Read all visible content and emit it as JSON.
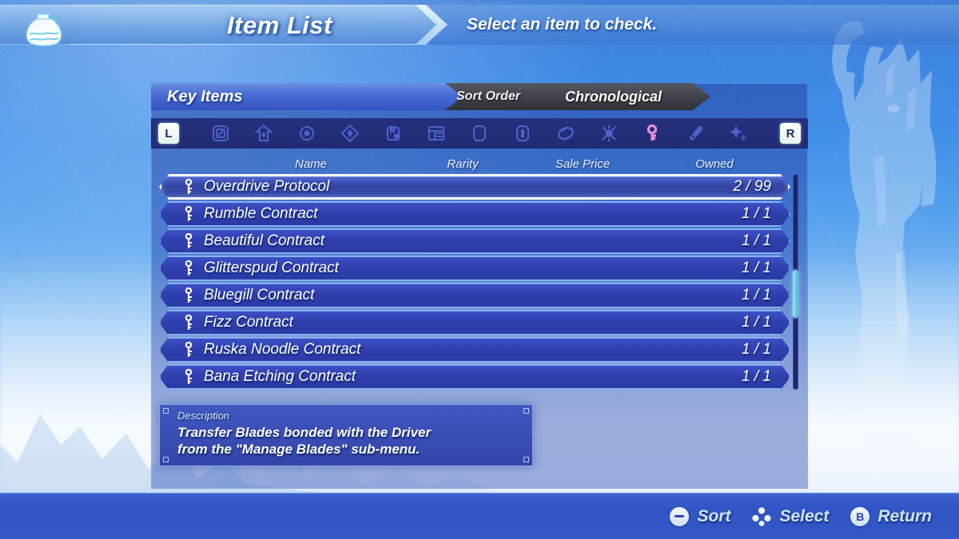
{
  "header": {
    "icon": "pot-icon",
    "title": "Item List",
    "subtitle": "Select an item to check."
  },
  "panel": {
    "category_tab": "Key Items",
    "sort_label": "Sort Order",
    "sort_value": "Chronological",
    "left_bumper": "L",
    "right_bumper": "R",
    "category_icons": [
      {
        "name": "core-chip-icon",
        "active": false
      },
      {
        "name": "aux-core-icon",
        "active": false
      },
      {
        "name": "pouch-item-icon",
        "active": false
      },
      {
        "name": "crystal-icon",
        "active": false
      },
      {
        "name": "collectible-icon",
        "active": false
      },
      {
        "name": "book-icon",
        "active": false
      },
      {
        "name": "cylinder-icon",
        "active": false
      },
      {
        "name": "ether-crystal-icon",
        "active": false
      },
      {
        "name": "ring-icon",
        "active": false
      },
      {
        "name": "accessory-icon",
        "active": false
      },
      {
        "name": "key-item-icon",
        "active": true
      },
      {
        "name": "treasure-icon",
        "active": false
      },
      {
        "name": "sparkle-icon",
        "active": false
      }
    ],
    "columns": [
      "Name",
      "Rarity",
      "Sale Price",
      "Owned"
    ],
    "items": [
      {
        "icon": "key-icon",
        "name": "Overdrive Protocol",
        "rarity": "",
        "sale_price": "",
        "owned": "2 / 99",
        "selected": true
      },
      {
        "icon": "key-icon",
        "name": "Rumble Contract",
        "rarity": "",
        "sale_price": "",
        "owned": "1 / 1",
        "selected": false
      },
      {
        "icon": "key-icon",
        "name": "Beautiful Contract",
        "rarity": "",
        "sale_price": "",
        "owned": "1 / 1",
        "selected": false
      },
      {
        "icon": "key-icon",
        "name": "Glitterspud Contract",
        "rarity": "",
        "sale_price": "",
        "owned": "1 / 1",
        "selected": false
      },
      {
        "icon": "key-icon",
        "name": "Bluegill Contract",
        "rarity": "",
        "sale_price": "",
        "owned": "1 / 1",
        "selected": false
      },
      {
        "icon": "key-icon",
        "name": "Fizz Contract",
        "rarity": "",
        "sale_price": "",
        "owned": "1 / 1",
        "selected": false
      },
      {
        "icon": "key-icon",
        "name": "Ruska Noodle Contract",
        "rarity": "",
        "sale_price": "",
        "owned": "1 / 1",
        "selected": false
      },
      {
        "icon": "key-icon",
        "name": "Bana Etching Contract",
        "rarity": "",
        "sale_price": "",
        "owned": "1 / 1",
        "selected": false
      }
    ],
    "description": {
      "label": "Description",
      "text": "Transfer Blades bonded with the Driver\nfrom the \"Manage Blades\" sub-menu."
    }
  },
  "footer": {
    "hints": [
      {
        "button": "minus-button-icon",
        "glyph": "−",
        "label": "Sort"
      },
      {
        "button": "stick-select-icon",
        "glyph": "",
        "label": "Select"
      },
      {
        "button": "b-button-icon",
        "glyph": "B",
        "label": "Return"
      }
    ]
  },
  "colors": {
    "accent_key_pink": "#e78fd2",
    "panel_blue": "#2f3fae",
    "selected_outline": "#ffffff",
    "scrollbar_thumb": "#6fd0e4",
    "footer_text": "#cfe2fb",
    "icon_dim": "#4a5cc4"
  }
}
